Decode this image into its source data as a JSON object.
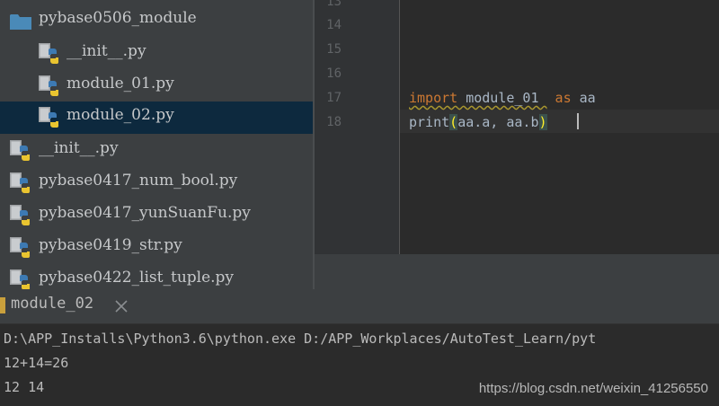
{
  "project_tree": {
    "items": [
      {
        "label": "pybase0506_module",
        "type": "folder"
      },
      {
        "label": "__init__.py",
        "type": "python-file"
      },
      {
        "label": "module_01.py",
        "type": "python-file"
      },
      {
        "label": "module_02.py",
        "type": "python-file",
        "selected": true
      },
      {
        "label": "__init__.py",
        "type": "python-file"
      },
      {
        "label": "pybase0417_num_bool.py",
        "type": "python-file"
      },
      {
        "label": "pybase0417_yunSuanFu.py",
        "type": "python-file"
      },
      {
        "label": "pybase0419_str.py",
        "type": "python-file"
      },
      {
        "label": "pybase0422_list_tuple.py",
        "type": "python-file"
      }
    ]
  },
  "editor": {
    "line_numbers": [
      "13",
      "14",
      "15",
      "16",
      "17",
      "18"
    ],
    "line17": {
      "import_kw": "import",
      "module": " module_01 ",
      "as_kw": " as",
      "alias": " aa"
    },
    "line18": {
      "fn": "print",
      "open": "(",
      "args": "aa.a, aa.b",
      "close": ")"
    }
  },
  "run_panel": {
    "tab_label": "module_02",
    "tab_icon": "run-config-icon",
    "output_lines": [
      "D:\\APP_Installs\\Python3.6\\python.exe D:/APP_Workplaces/AutoTest_Learn/pyt",
      "12+14=26",
      "12 14"
    ]
  },
  "watermark": "https://blog.csdn.net/weixin_41256550",
  "colors": {
    "tree_bg": "#3c3f41",
    "selection": "#0d293e",
    "editor_bg": "#2b2b2b",
    "keyword": "#cc7832",
    "text": "#a9b7c6"
  }
}
